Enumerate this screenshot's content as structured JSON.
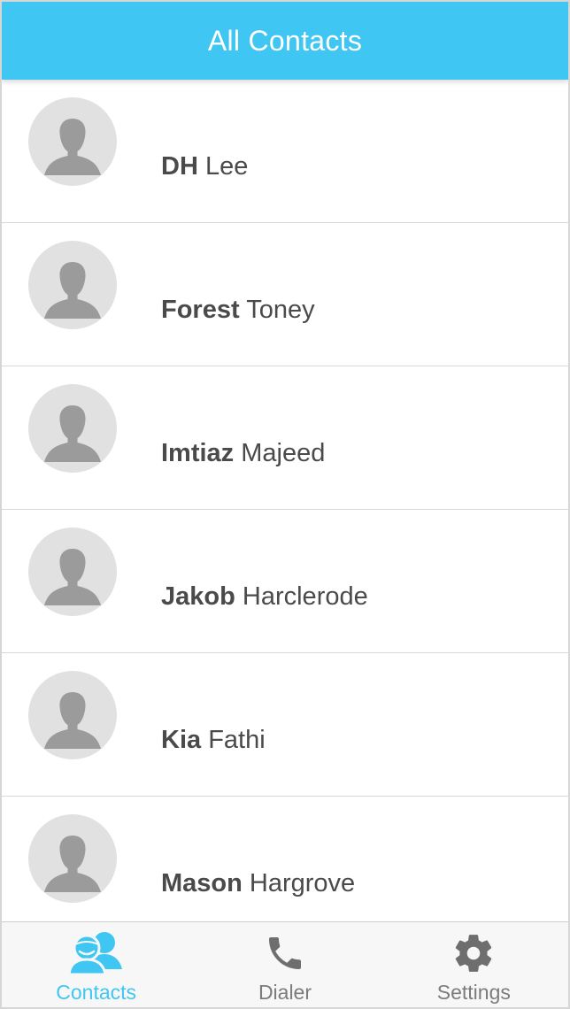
{
  "header": {
    "title": "All Contacts"
  },
  "contacts": [
    {
      "first": "DH",
      "last": "Lee"
    },
    {
      "first": "Forest",
      "last": "Toney"
    },
    {
      "first": "Imtiaz",
      "last": "Majeed"
    },
    {
      "first": "Jakob",
      "last": "Harclerode"
    },
    {
      "first": "Kia",
      "last": "Fathi"
    },
    {
      "first": "Mason",
      "last": "Hargrove"
    }
  ],
  "tabs": [
    {
      "label": "Contacts",
      "icon": "contacts-icon",
      "active": true
    },
    {
      "label": "Dialer",
      "icon": "phone-icon",
      "active": false
    },
    {
      "label": "Settings",
      "icon": "gear-icon",
      "active": false
    }
  ],
  "colors": {
    "accent": "#40c6f3",
    "inactive": "#7c7c7c",
    "avatar_bg": "#e1e1e1",
    "avatar_fg": "#9b9b9b"
  }
}
